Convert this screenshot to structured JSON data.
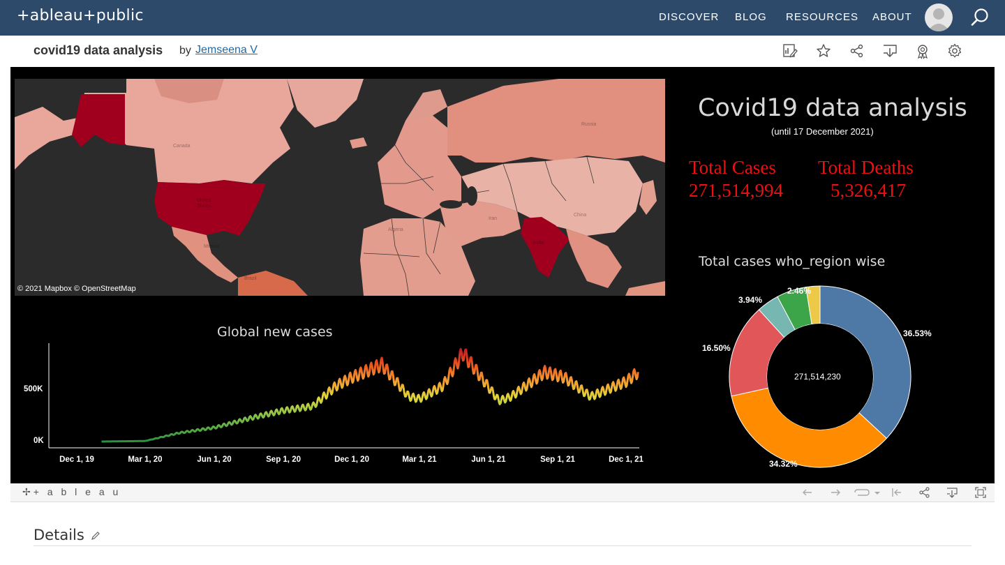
{
  "nav": {
    "logo": "+ableau+public",
    "links": [
      "DISCOVER",
      "BLOG",
      "RESOURCES",
      "ABOUT"
    ]
  },
  "viz": {
    "title": "covid19 data analysis",
    "by": "by",
    "author": "Jemseena V"
  },
  "dashboard": {
    "map_credit": "© 2021 Mapbox  © OpenStreetMap",
    "map_labels": {
      "canada": "Canada",
      "us": "United States",
      "russia": "Russia",
      "china": "China",
      "india": "India",
      "algeria": "Algeria",
      "iran": "Iran",
      "mexico": "Mexico",
      "brazil": "Brazil"
    },
    "title": "Covid19 data analysis",
    "subtitle": "(until 17 December 2021)",
    "total_cases_label": "Total Cases",
    "total_cases_value": "271,514,994",
    "total_deaths_label": "Total Deaths",
    "total_deaths_value": "5,326,417",
    "line_title": "Global new cases",
    "donut_title": "Total cases who_region wise",
    "donut_center": "271,514,230"
  },
  "chart_data": [
    {
      "type": "line",
      "title": "Global new cases",
      "x_tick_labels": [
        "Dec 1, 19",
        "Mar 1, 20",
        "Jun 1, 20",
        "Sep 1, 20",
        "Dec 1, 20",
        "Mar 1, 21",
        "Jun 1, 21",
        "Sep 1, 21",
        "Dec 1, 21"
      ],
      "y_tick_labels": [
        "500K",
        "0K"
      ],
      "y_ticks": [
        500000,
        0
      ],
      "ylim": [
        0,
        900000
      ],
      "x": [
        "2020-01-03",
        "2020-03-01",
        "2020-04-15",
        "2020-06-01",
        "2020-07-20",
        "2020-09-01",
        "2020-10-10",
        "2020-11-10",
        "2020-12-01",
        "2021-01-10",
        "2021-02-15",
        "2021-03-01",
        "2021-04-01",
        "2021-04-28",
        "2021-05-20",
        "2021-06-15",
        "2021-07-01",
        "2021-08-15",
        "2021-09-10",
        "2021-10-15",
        "2021-11-10",
        "2021-12-01",
        "2021-12-17"
      ],
      "values": [
        0,
        5000,
        80000,
        130000,
        220000,
        290000,
        330000,
        520000,
        600000,
        720000,
        420000,
        400000,
        520000,
        830000,
        620000,
        380000,
        420000,
        650000,
        600000,
        420000,
        500000,
        560000,
        650000
      ]
    },
    {
      "type": "pie",
      "title": "Total cases who_region wise",
      "center_label": "271,514,230",
      "slices": [
        {
          "value": 36.53,
          "label": "36.53%",
          "color": "#4e79a7"
        },
        {
          "value": 34.32,
          "label": "34.32%",
          "color": "#ff8c00"
        },
        {
          "value": 16.5,
          "label": "16.50%",
          "color": "#e15759"
        },
        {
          "value": 3.94,
          "label": "3.94%",
          "color": "#76b7b2"
        },
        {
          "value": 5.25,
          "label": "",
          "color": "#3ca54a"
        },
        {
          "value": 2.46,
          "label": "2.46%",
          "color": "#edc948"
        }
      ]
    }
  ],
  "footer_logo": "+ a b l e a u",
  "details": {
    "heading": "Details"
  },
  "colors": {
    "nav_bg": "#2d4a6b",
    "map_dark": "#a0001e",
    "kpi_red": "#ee1010"
  }
}
